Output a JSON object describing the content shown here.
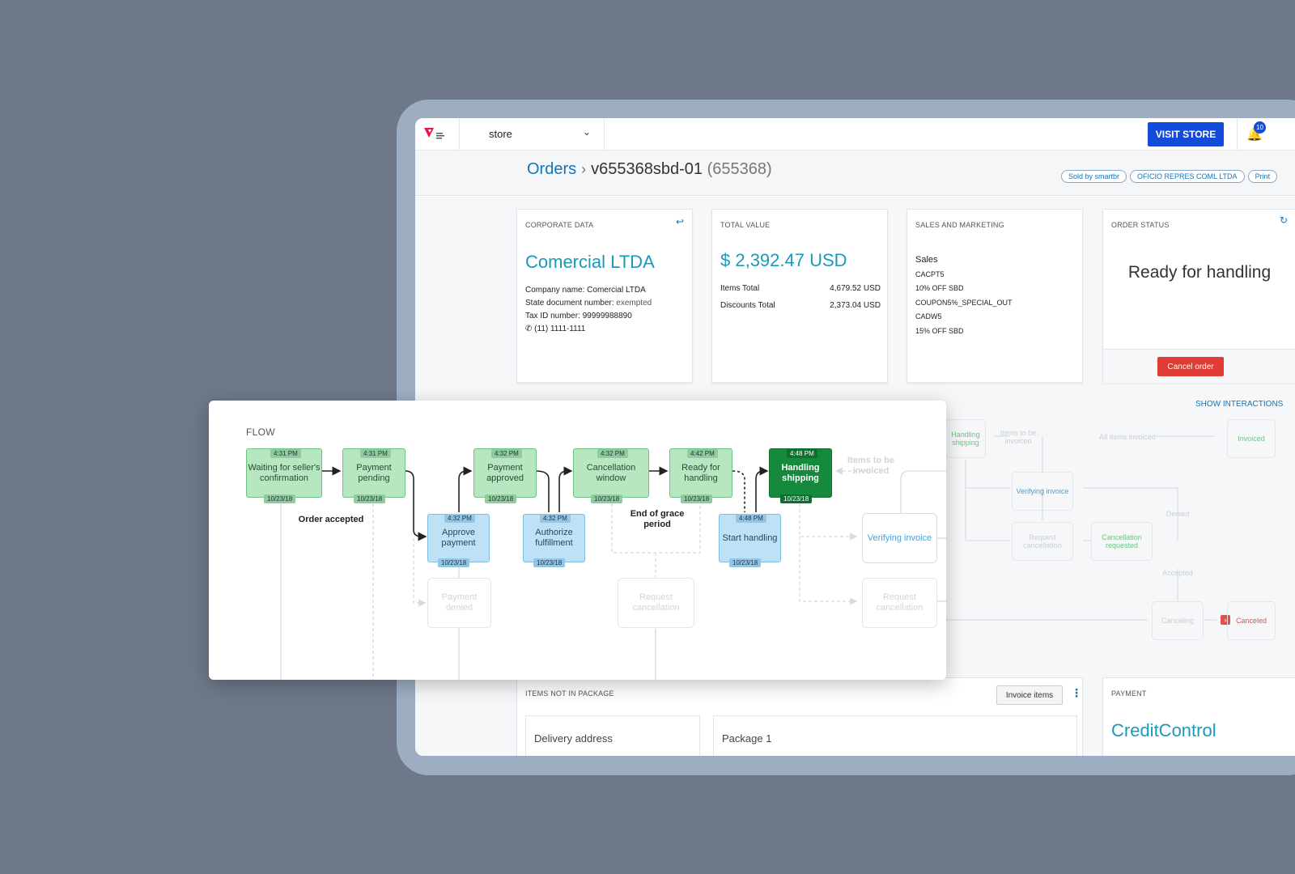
{
  "topbar": {
    "store": "store",
    "visit_store": "VISIT STORE",
    "notifications": "10"
  },
  "breadcrumb": {
    "root": "Orders",
    "order_id": "v655368sbd-01",
    "order_num": "(655368)"
  },
  "tags": [
    "Sold by smartbr",
    "OFICIO REPRES COML LTDA",
    "Print"
  ],
  "corporate": {
    "header": "CORPORATE DATA",
    "company": "Comercial LTDA",
    "company_name_label": "Company name:",
    "company_name": "Comercial LTDA",
    "state_doc_label": "State document number:",
    "state_doc": "exempted",
    "tax_label": "Tax ID number:",
    "tax_id": "99999988890",
    "phone": "(11) 1111-1111"
  },
  "total": {
    "header": "TOTAL VALUE",
    "value": "$ 2,392.47 USD",
    "items_label": "Items Total",
    "items_value": "4,679.52 USD",
    "discounts_label": "Discounts Total",
    "discounts_value": "2,373.04 USD"
  },
  "sales": {
    "header": "SALES AND MARKETING",
    "title": "Sales",
    "lines": [
      "CACPT5",
      "10% OFF SBD",
      "COUPON5%_SPECIAL_OUT",
      "CADW5",
      "15% OFF SBD"
    ]
  },
  "order_status": {
    "header": "ORDER STATUS",
    "status": "Ready for handling",
    "cancel": "Cancel order"
  },
  "show_interactions": "SHOW INTERACTIONS",
  "items_not_in_package": {
    "header": "ITEMS NOT IN PACKAGE",
    "invoice_button": "Invoice items",
    "delivery": "Delivery address",
    "package": "Package 1"
  },
  "payment": {
    "header": "PAYMENT",
    "method": "CreditControl"
  },
  "flow": {
    "title": "FLOW",
    "nodes": {
      "waiting": {
        "label": "Waiting for seller's confirmation",
        "time": "4:31 PM",
        "date": "10/23/18"
      },
      "payment_pending": {
        "label": "Payment pending",
        "time": "4:31 PM",
        "date": "10/23/18"
      },
      "approve_payment": {
        "label": "Approve payment",
        "time": "4:32 PM",
        "date": "10/23/18"
      },
      "payment_approved": {
        "label": "Payment approved",
        "time": "4:32 PM",
        "date": "10/23/18"
      },
      "authorize": {
        "label": "Authorize fulfillment",
        "time": "4:32 PM",
        "date": "10/23/18"
      },
      "cancellation_window": {
        "label": "Cancellation window",
        "time": "4:32 PM",
        "date": "10/23/18"
      },
      "ready": {
        "label": "Ready for handling",
        "time": "4:42 PM",
        "date": "10/23/18"
      },
      "start_handling": {
        "label": "Start handling",
        "time": "4:48 PM",
        "date": "10/23/18"
      },
      "handling_shipping": {
        "label": "Handling shipping",
        "time": "4:48 PM",
        "date": "10/23/18"
      },
      "payment_denied": {
        "label": "Payment denied"
      },
      "request_cancel_1": {
        "label": "Request cancellation"
      },
      "request_cancel_2": {
        "label": "Request cancellation"
      },
      "verifying_invoice": {
        "label": "Verifying invoice"
      },
      "items_to_be_invoiced": {
        "label": "Items to be invoiced"
      }
    },
    "order_accepted": "Order accepted",
    "end_grace": "End of grace period"
  },
  "bgflow": {
    "handling_shipping": "Handling shipping",
    "items_to_be_invoiced": "Items to be invoiced",
    "all_items_invoiced": "All items invoiced",
    "invoiced": "Invoiced",
    "verifying_invoice": "Verifying invoice",
    "request_cancellation": "Request cancellation",
    "cancellation_requested": "Cancellation requested",
    "denied": "Denied",
    "accepted": "Accepted",
    "canceling": "Canceling",
    "canceled": "Canceled"
  }
}
